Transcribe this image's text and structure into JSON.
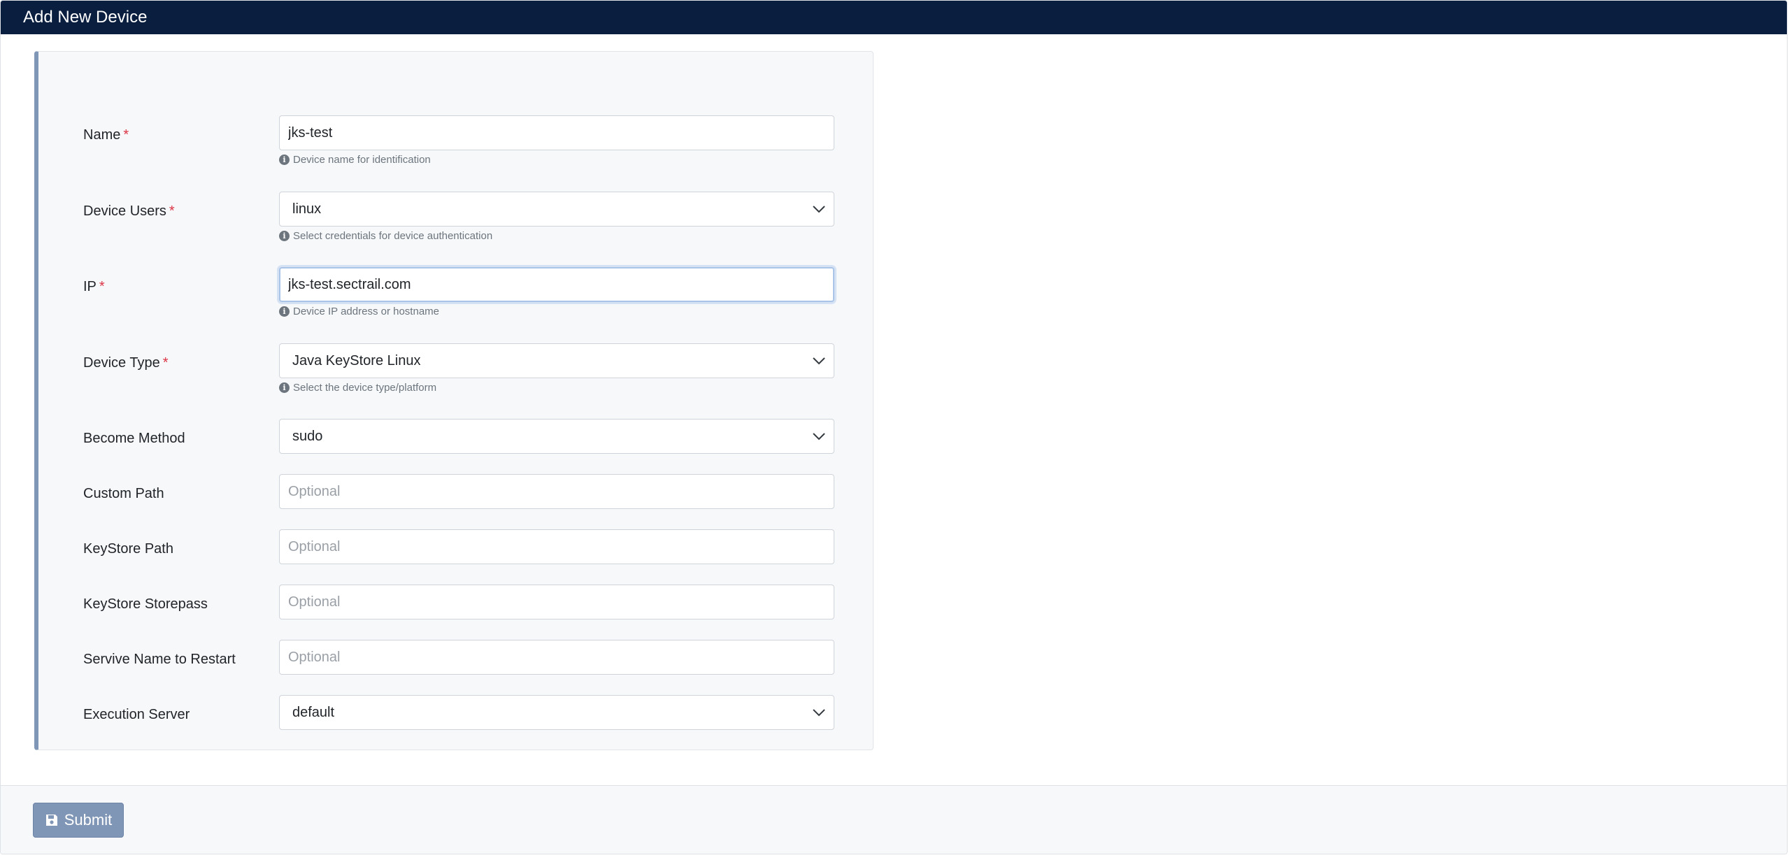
{
  "header": {
    "title": "Add New Device"
  },
  "form": {
    "fields": [
      {
        "label": "Name",
        "required_mark": "*",
        "value": "jks-test",
        "help": "Device name for identification"
      },
      {
        "label": "Device Users",
        "required_mark": "*",
        "selected": "linux",
        "help": "Select credentials for device authentication"
      },
      {
        "label": "IP",
        "required_mark": "*",
        "value": "jks-test.sectrail.com",
        "help": "Device IP address or hostname"
      },
      {
        "label": "Device Type",
        "required_mark": "*",
        "selected": "Java KeyStore Linux",
        "help": "Select the device type/platform"
      },
      {
        "label": "Become Method",
        "selected": "sudo"
      },
      {
        "label": "Custom Path",
        "placeholder": "Optional"
      },
      {
        "label": "KeyStore Path",
        "placeholder": "Optional"
      },
      {
        "label": "KeyStore Storepass",
        "placeholder": "Optional"
      },
      {
        "label": "Servive Name to Restart",
        "placeholder": "Optional"
      },
      {
        "label": "Execution Server",
        "selected": "default"
      }
    ]
  },
  "footer": {
    "submit_label": "Submit"
  },
  "colors": {
    "header_bg": "#0a1f3f",
    "required": "#dc3545",
    "accent": "#7f96b6",
    "panel_bg": "#f7f8fa"
  },
  "icons": {
    "help": "info-circle-icon",
    "select_arrow": "chevron-down-icon",
    "submit": "floppy-disk-icon"
  }
}
